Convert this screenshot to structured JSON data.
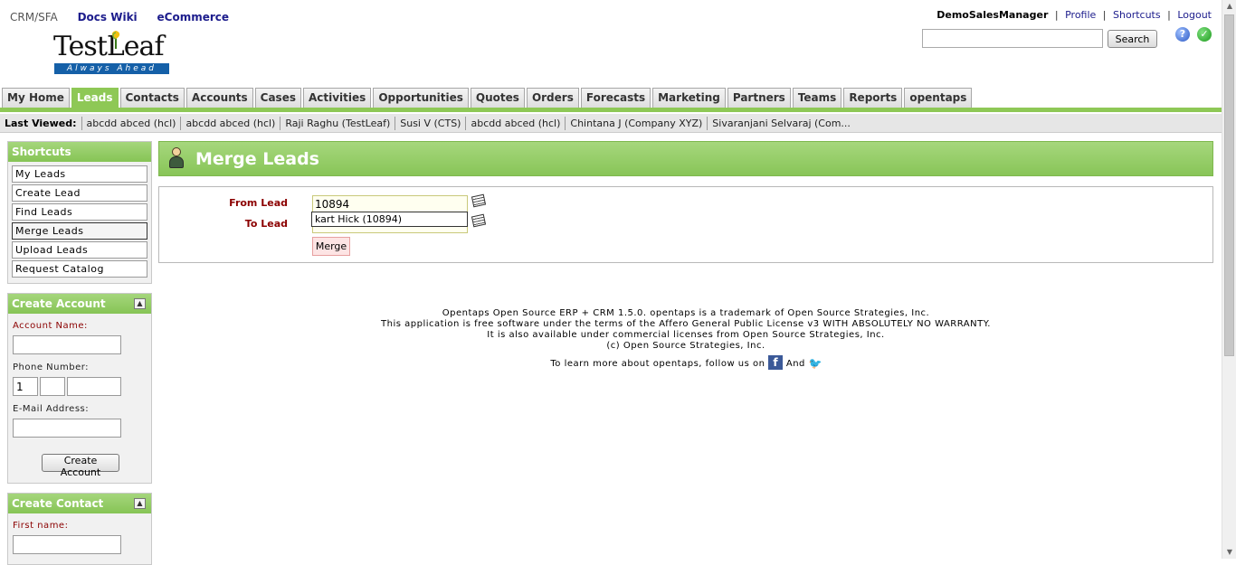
{
  "app_links": {
    "crm": "CRM/SFA",
    "docs": "Docs Wiki",
    "ecommerce": "eCommerce"
  },
  "logo": {
    "name": "TestLeaf",
    "tagline": "Always Ahead"
  },
  "user_bar": {
    "user": "DemoSalesManager",
    "profile": "Profile",
    "shortcuts": "Shortcuts",
    "logout": "Logout",
    "separator": "|"
  },
  "search": {
    "button": "Search",
    "value": ""
  },
  "tabs": [
    "My Home",
    "Leads",
    "Contacts",
    "Accounts",
    "Cases",
    "Activities",
    "Opportunities",
    "Quotes",
    "Orders",
    "Forecasts",
    "Marketing",
    "Partners",
    "Teams",
    "Reports",
    "opentaps"
  ],
  "active_tab": "Leads",
  "last_viewed": {
    "label": "Last Viewed:",
    "items": [
      "abcdd abced (hcl)",
      "abcdd abced (hcl)",
      "Raji Raghu (TestLeaf)",
      "Susi V (CTS)",
      "abcdd abced (hcl)",
      "Chintana J (Company XYZ)",
      "Sivaranjani Selvaraj (Com..."
    ]
  },
  "shortcuts": {
    "title": "Shortcuts",
    "items": [
      "My Leads",
      "Create Lead",
      "Find Leads",
      "Merge Leads",
      "Upload Leads",
      "Request Catalog"
    ]
  },
  "create_account": {
    "title": "Create Account",
    "account_name_label": "Account Name:",
    "phone_label": "Phone Number:",
    "phone_country_code": "1",
    "email_label": "E-Mail Address:",
    "button": "Create Account"
  },
  "create_contact": {
    "title": "Create Contact",
    "first_name_label": "First name:"
  },
  "main": {
    "title": "Merge Leads",
    "from_label": "From Lead",
    "from_value": "10894",
    "to_label": "To Lead",
    "suggestion": "kart Hick (10894)",
    "merge_button": "Merge"
  },
  "footer": {
    "line1": "Opentaps Open Source ERP + CRM 1.5.0. opentaps is a trademark of Open Source Strategies, Inc.",
    "line2": "This application is free software under the terms of the Affero General Public License v3 WITH ABSOLUTELY NO WARRANTY.",
    "line3": "It is also available under commercial licenses from Open Source Strategies, Inc.",
    "line4": "(c) Open Source Strategies, Inc.",
    "follow_text": "To learn more about opentaps, follow us on",
    "and_text": "And"
  },
  "colors": {
    "accent_green": "#8ec856",
    "link_blue": "#1c1c8c",
    "required_red": "#8b0000"
  }
}
